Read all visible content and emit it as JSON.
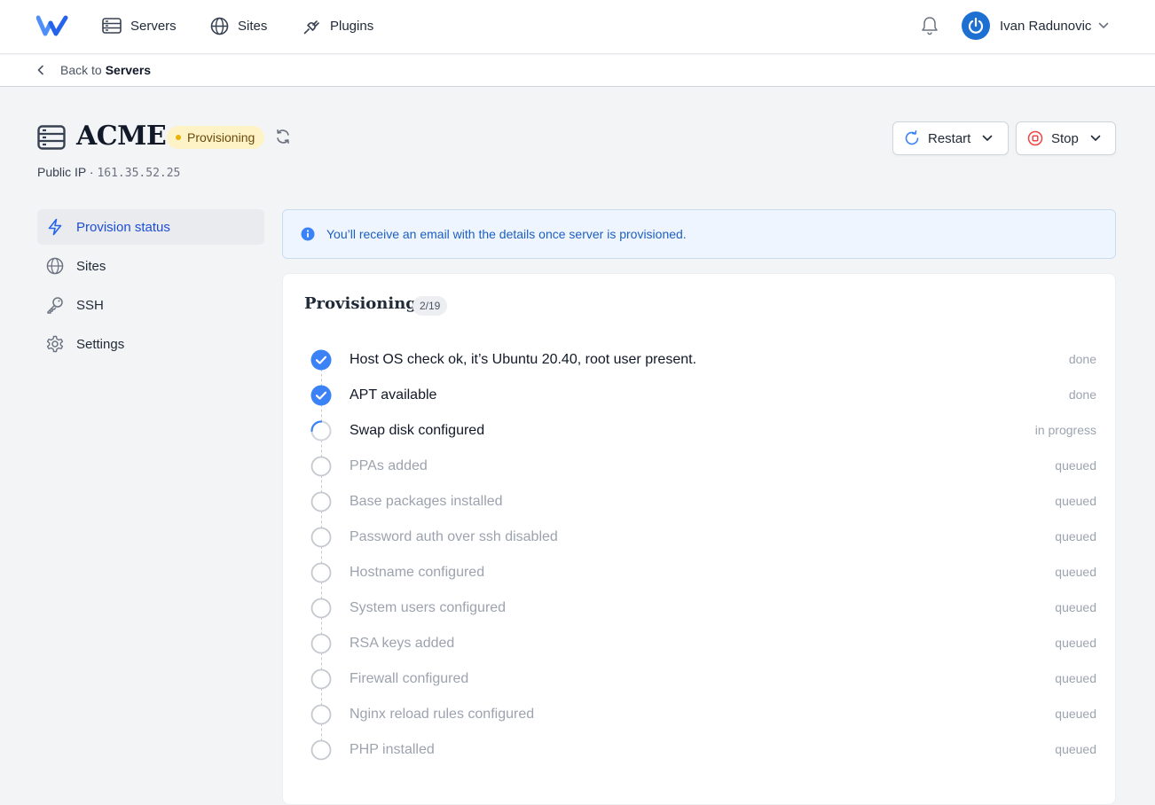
{
  "nav": {
    "logo_icon": "w-logo-icon",
    "items": [
      {
        "label": "Servers",
        "icon": "server-icon"
      },
      {
        "label": "Sites",
        "icon": "globe-icon"
      },
      {
        "label": "Plugins",
        "icon": "plug-icon"
      }
    ],
    "user": {
      "name": "Ivan Radunovic",
      "avatar_icon": "power-icon"
    }
  },
  "breadcrumb": {
    "prefix": "Back to",
    "target": "Servers"
  },
  "server": {
    "name": "ACME",
    "status": "Provisioning",
    "public_ip_label": "Public IP",
    "separator": "·",
    "public_ip": "161.35.52.25"
  },
  "actions": {
    "restart": "Restart",
    "stop": "Stop"
  },
  "sidebar": {
    "items": [
      {
        "label": "Provision status",
        "icon": "bolt-icon",
        "active": true
      },
      {
        "label": "Sites",
        "icon": "globe-icon"
      },
      {
        "label": "SSH",
        "icon": "key-icon"
      },
      {
        "label": "Settings",
        "icon": "gear-icon"
      }
    ]
  },
  "alert": {
    "text": "You’ll receive an email with the details once server is provisioned."
  },
  "provisioning": {
    "title": "Provisioning",
    "count": "2/19",
    "steps": [
      {
        "label": "Host OS check ok, it’s Ubuntu 20.40, root user present.",
        "state": "done"
      },
      {
        "label": "APT available",
        "state": "done"
      },
      {
        "label": "Swap disk configured",
        "state": "in progress"
      },
      {
        "label": "PPAs added",
        "state": "queued"
      },
      {
        "label": "Base packages installed",
        "state": "queued"
      },
      {
        "label": "Password auth over ssh disabled",
        "state": "queued"
      },
      {
        "label": "Hostname configured",
        "state": "queued"
      },
      {
        "label": "System users configured",
        "state": "queued"
      },
      {
        "label": "RSA keys added",
        "state": "queued"
      },
      {
        "label": "Firewall configured",
        "state": "queued"
      },
      {
        "label": "Nginx reload rules configured",
        "state": "queued"
      },
      {
        "label": "PHP installed",
        "state": "queued"
      }
    ]
  },
  "colors": {
    "accent": "#3b82f6",
    "done": "#3b82f6",
    "queued": "#9ca3af",
    "badge_bg": "#fef3c7"
  }
}
